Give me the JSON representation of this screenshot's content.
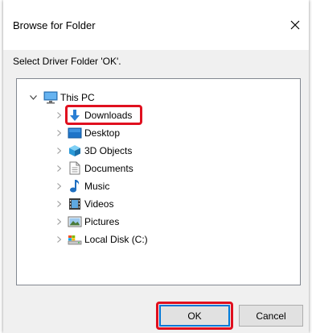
{
  "window": {
    "title": "Browse for Folder"
  },
  "prompt": "Select Driver Folder 'OK'.",
  "tree": {
    "root": {
      "label": "This PC",
      "icon": "monitor-icon",
      "expanded": true
    },
    "items": [
      {
        "label": "Downloads",
        "icon": "download-arrow-icon",
        "highlighted": true
      },
      {
        "label": "Desktop",
        "icon": "desktop-folder-icon"
      },
      {
        "label": "3D Objects",
        "icon": "3d-objects-icon"
      },
      {
        "label": "Documents",
        "icon": "document-icon"
      },
      {
        "label": "Music",
        "icon": "music-note-icon"
      },
      {
        "label": "Videos",
        "icon": "film-icon"
      },
      {
        "label": "Pictures",
        "icon": "pictures-icon"
      },
      {
        "label": "Local Disk (C:)",
        "icon": "drive-icon"
      }
    ]
  },
  "buttons": {
    "ok": "OK",
    "cancel": "Cancel"
  },
  "colors": {
    "highlight": "#e0101f",
    "accent": "#0078d7",
    "dialog_bg": "#f0f0f0"
  }
}
